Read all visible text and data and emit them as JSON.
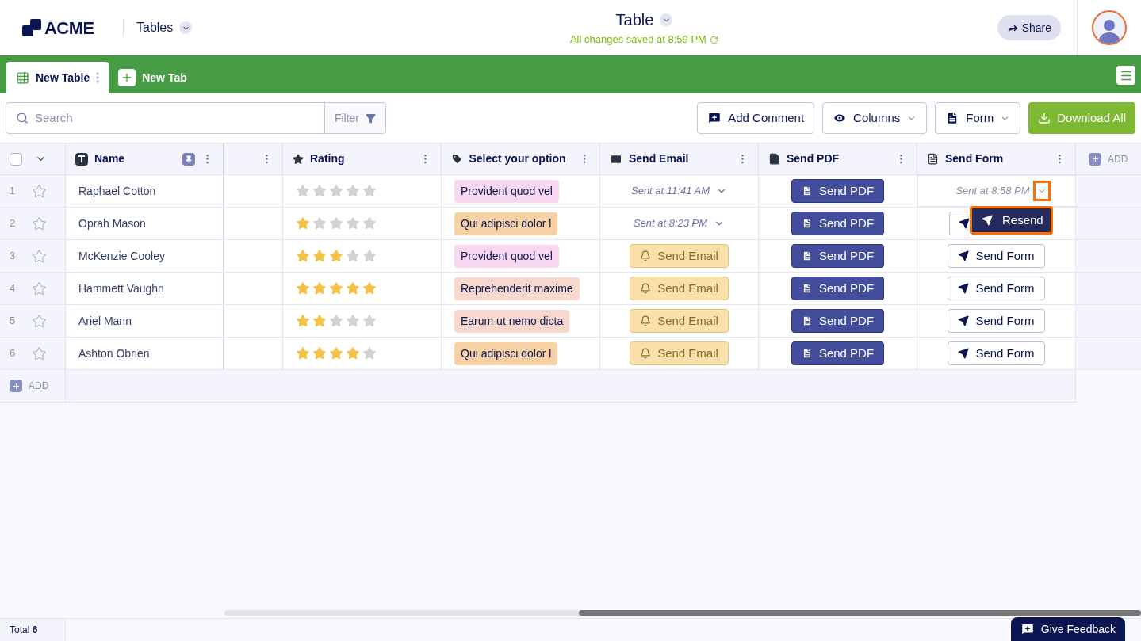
{
  "header": {
    "logo": "ACME",
    "section": "Tables",
    "title": "Table",
    "status": "All changes saved at 8:59 PM",
    "share": "Share"
  },
  "tabs": [
    {
      "label": "New Table",
      "selected": true
    },
    {
      "label": "New Tab",
      "selected": false,
      "kind": "add"
    }
  ],
  "toolbar": {
    "search_placeholder": "Search",
    "filter": "Filter",
    "buttons": [
      {
        "label": "Add Comment",
        "kind": "comment"
      },
      {
        "label": "Columns",
        "kind": "columns"
      },
      {
        "label": "Form",
        "kind": "form"
      },
      {
        "label": "Download All",
        "kind": "download"
      }
    ]
  },
  "table": {
    "select_all_checked": false,
    "columns": [
      {
        "label": "Name",
        "kind": "name"
      },
      {
        "kind": "blank"
      },
      {
        "label": "Rating",
        "kind": "rating"
      },
      {
        "label": "Select your option",
        "kind": "option"
      },
      {
        "label": "Send Email",
        "kind": "email"
      },
      {
        "label": "Send PDF",
        "kind": "pdf"
      },
      {
        "label": "Send Form",
        "kind": "form"
      }
    ],
    "add_column": "ADD",
    "rows": [
      {
        "index": "1",
        "name": "Raphael Cotton",
        "stars": 0,
        "option": {
          "text": "Provident quod vel",
          "color": "#f8d8f0"
        },
        "email": {
          "kind": "sent",
          "text": "Sent at 11:41 AM"
        },
        "pdf": "Send PDF",
        "form": {
          "kind": "sent",
          "text": "Sent at 8:58 PM",
          "selected": true
        }
      },
      {
        "index": "2",
        "name": "Oprah Mason",
        "stars": 1,
        "option": {
          "text": "Qui adipisci dolor l",
          "color": "#f7d0a4"
        },
        "email": {
          "kind": "sent",
          "text": "Sent at 8:23 PM"
        },
        "pdf": "Send PDF",
        "form": {
          "kind": "covered",
          "selected": false
        }
      },
      {
        "index": "3",
        "name": "McKenzie Cooley",
        "stars": 3,
        "option": {
          "text": "Provident quod vel",
          "color": "#f8d8f0"
        },
        "email": {
          "kind": "button",
          "text": "Send Email"
        },
        "pdf": "Send PDF",
        "form": {
          "kind": "button",
          "text": "Send Form",
          "selected": false
        }
      },
      {
        "index": "4",
        "name": "Hammett Vaughn",
        "stars": 5,
        "option": {
          "text": "Reprehenderit maxime",
          "color": "#f8d8cc"
        },
        "email": {
          "kind": "button",
          "text": "Send Email"
        },
        "pdf": "Send PDF",
        "form": {
          "kind": "button",
          "text": "Send Form",
          "selected": false
        }
      },
      {
        "index": "5",
        "name": "Ariel Mann",
        "stars": 2,
        "option": {
          "text": "Earum ut nemo dicta",
          "color": "#f8d8cc"
        },
        "email": {
          "kind": "button",
          "text": "Send Email"
        },
        "pdf": "Send PDF",
        "form": {
          "kind": "button",
          "text": "Send Form",
          "selected": false
        }
      },
      {
        "index": "6",
        "name": "Ashton Obrien",
        "stars": 4,
        "option": {
          "text": "Qui adipisci dolor l",
          "color": "#f7d0a4"
        },
        "email": {
          "kind": "button",
          "text": "Send Email"
        },
        "pdf": "Send PDF",
        "form": {
          "kind": "button",
          "text": "Send Form",
          "selected": false
        }
      }
    ],
    "add_row": "ADD"
  },
  "popup": {
    "label": "Resend"
  },
  "footer": {
    "total": "Total **6**",
    "feedback": "Give Feedback"
  }
}
